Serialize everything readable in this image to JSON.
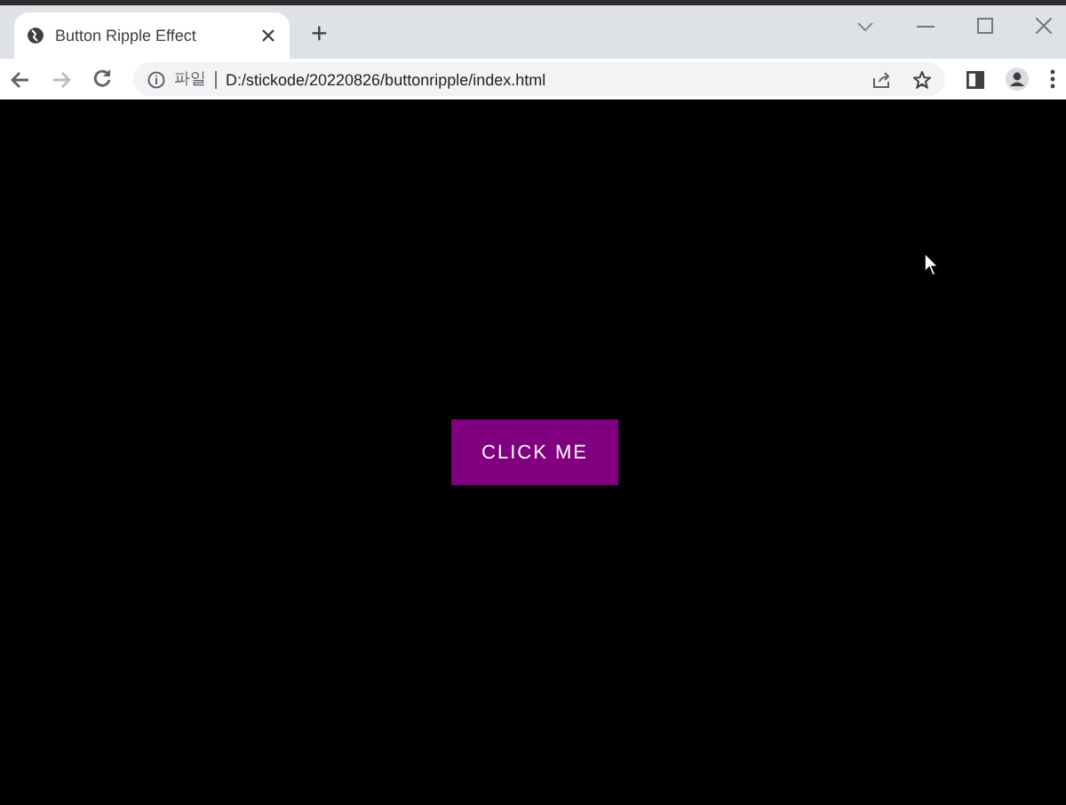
{
  "tab": {
    "title": "Button Ripple Effect",
    "selected": true
  },
  "new_tab": "+",
  "address_bar": {
    "scheme_label": "파일",
    "url": "D:/stickode/20220826/buttonripple/index.html"
  },
  "page": {
    "button": "CLICK ME"
  }
}
